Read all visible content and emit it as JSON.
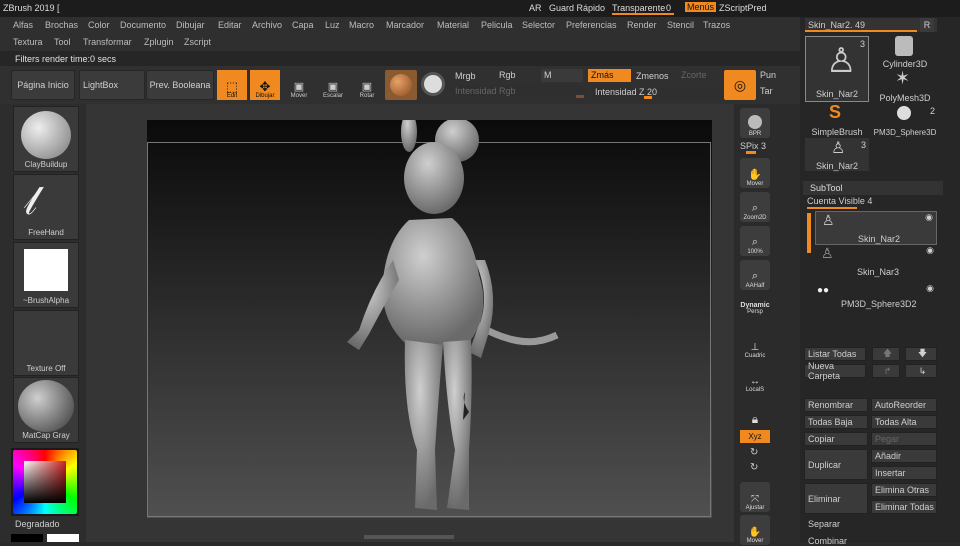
{
  "titlebar": {
    "app": "ZBrush 2019 [",
    "ar": "AR",
    "guard": "Guard Rápido",
    "transparente": "Transparente",
    "trans_val": "0",
    "menus": "Menús",
    "zscriptpred": "ZScriptPred"
  },
  "menu_row1": [
    "Alfas",
    "Brochas",
    "Color",
    "Documento",
    "Dibujar",
    "Editar",
    "Archivo",
    "Capa",
    "Luz",
    "Macro",
    "Marcador",
    "Material",
    "Pelicula",
    "Selector",
    "Preferencias",
    "Render",
    "Stencil",
    "Trazos"
  ],
  "menu_row2": [
    "Textura",
    "Tool",
    "Transformar",
    "Zplugin",
    "Zscript"
  ],
  "infobar": "Filters render time:0 secs",
  "toolbar": {
    "pagina": "Página Inicio",
    "lightbox": "LightBox",
    "prev": "Prev. Booleana",
    "edit": "Edit",
    "dibujar": "Dibujar",
    "mover": "Mover",
    "escalar": "Escalar",
    "rotar": "Rotar",
    "mrgb": "Mrgb",
    "rgb": "Rgb",
    "m": "M",
    "zmas": "Zmás",
    "zmenos": "Zmenos",
    "zcorte": "Zcorte",
    "intensidad_rgb": "Intensidad Rgb",
    "intensidad_z": "Intensidad Z",
    "intensidad_z_val": "20",
    "pun": "Pun",
    "tar": "Tar"
  },
  "lefttray": {
    "brush": "ClayBuildup",
    "stroke": "FreeHand",
    "alpha": "~BrushAlpha",
    "texture": "Texture Off",
    "material": "MatCap Gray",
    "degradado": "Degradado"
  },
  "righttray": {
    "bpr": "BPR",
    "spix": "SPix",
    "spix_val": "3",
    "move": "Mover",
    "zoom": "Zoom2D",
    "actual": "100%",
    "aahalf": "AAHalf",
    "dynamic": "Dynamic",
    "persp": "Persp",
    "floor": "Cuadric",
    "local": "LocalS",
    "xyz": "Xyz",
    "ajustar": "Ajustar",
    "mover2": "Mover"
  },
  "rightpanel": {
    "tool_name": "Skin_Nar2. 49",
    "r": "R",
    "tools": [
      {
        "label": "Skin_Nar2",
        "count": "3"
      },
      {
        "label": "Cylinder3D",
        "count": ""
      },
      {
        "label": "PolyMesh3D",
        "count": ""
      },
      {
        "label": "SimpleBrush",
        "count": ""
      },
      {
        "label": "PM3D_Sphere3D",
        "count": "2"
      },
      {
        "label": "Skin_Nar2",
        "count": "3"
      }
    ],
    "subtool": "SubTool",
    "cuenta": "Cuenta Visible 4",
    "subtools": [
      "Skin_Nar2",
      "Skin_Nar3",
      "PM3D_Sphere3D2"
    ],
    "listar": "Listar Todas",
    "nueva": "Nueva Carpeta",
    "renombrar": "Renombrar",
    "autoreorder": "AutoReorder",
    "todas_baja": "Todas Baja",
    "todas_alta": "Todas Alta",
    "copiar": "Copiar",
    "pegar": "Pegar",
    "duplicar": "Duplicar",
    "anadir": "Añadir",
    "insertar": "Insertar",
    "eliminar": "Eliminar",
    "elim_otras": "Elimina Otras",
    "elim_todas": "Eliminar Todas",
    "separar": "Separar",
    "combinar": "Combinar"
  }
}
